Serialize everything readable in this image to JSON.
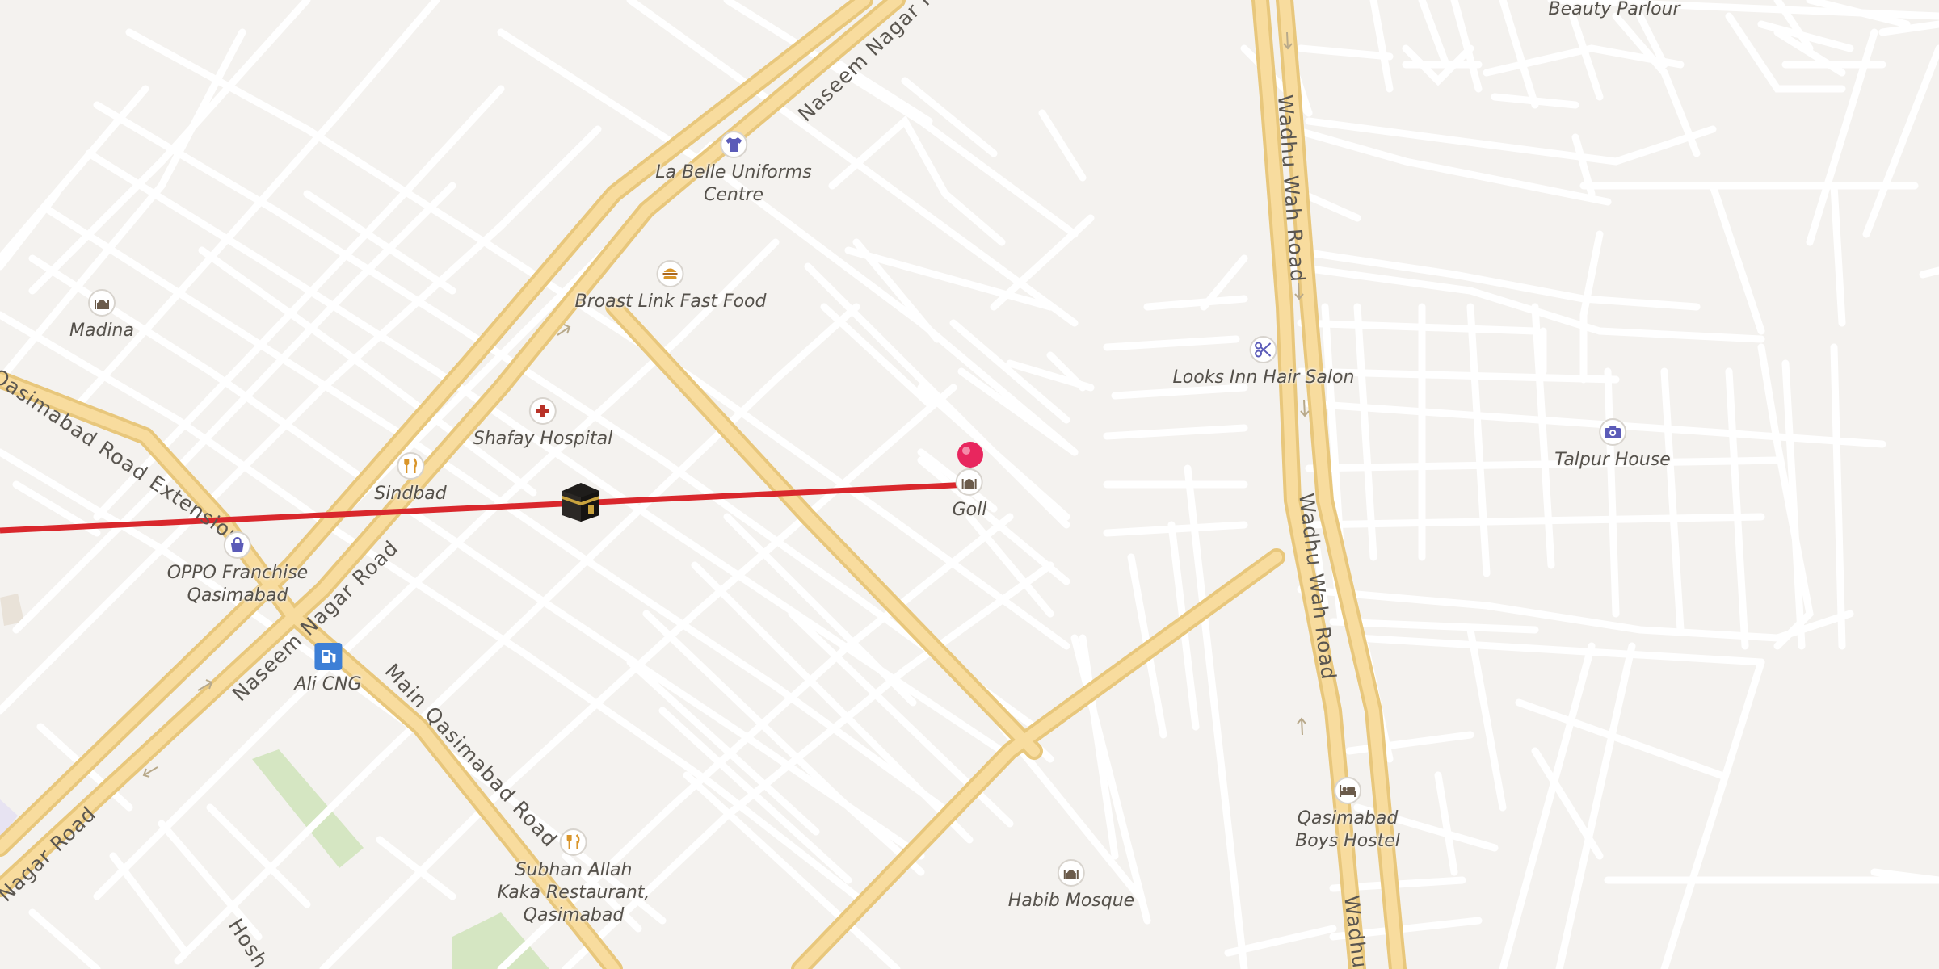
{
  "map": {
    "streets": [
      {
        "id": "naseem-nagar-top",
        "text": "Naseem Nagar Road"
      },
      {
        "id": "naseem-nagar-mid",
        "text": "Naseem Nagar Road"
      },
      {
        "id": "naseem-nagar-bottom",
        "text": "Nagar Road"
      },
      {
        "id": "qasimabad-ext",
        "text": "Qasimabad Road Extension"
      },
      {
        "id": "main-qasimabad",
        "text": "Main Qasimabad Road"
      },
      {
        "id": "wadhu-wah-top",
        "text": "Wadhu Wah Road"
      },
      {
        "id": "wadhu-wah-mid",
        "text": "Wadhu Wah Road"
      },
      {
        "id": "wadhu-wah-bottom",
        "text": "Wadhu"
      },
      {
        "id": "hosh",
        "text": "Hosh"
      }
    ],
    "pois": [
      {
        "id": "la-belle",
        "lines": [
          "La Belle Uniforms",
          "Centre"
        ],
        "icon": "shirt-icon",
        "color": "#5b5bb8"
      },
      {
        "id": "broast-link",
        "lines": [
          "Broast Link Fast Food"
        ],
        "icon": "burger-icon",
        "color": "#d9952a"
      },
      {
        "id": "madina",
        "lines": [
          "Madina"
        ],
        "icon": "mosque-icon",
        "color": "#6b5b4b"
      },
      {
        "id": "shafay",
        "lines": [
          "Shafay Hospital"
        ],
        "icon": "hospital-cross-icon",
        "color": "#b83228"
      },
      {
        "id": "sindbad",
        "lines": [
          "Sindbad"
        ],
        "icon": "restaurant-icon",
        "color": "#d9952a"
      },
      {
        "id": "oppo",
        "lines": [
          "OPPO Franchise",
          "Qasimabad"
        ],
        "icon": "shopping-bag-icon",
        "color": "#5b5bb8"
      },
      {
        "id": "ali-cng",
        "lines": [
          "Ali CNG"
        ],
        "icon": "fuel-icon",
        "color": "#3d7fd6"
      },
      {
        "id": "goll",
        "lines": [
          "Goll"
        ],
        "icon": "mosque-icon",
        "color": "#6b5b4b"
      },
      {
        "id": "looks-inn",
        "lines": [
          "Looks Inn Hair Salon"
        ],
        "icon": "scissors-icon",
        "color": "#5b5bb8"
      },
      {
        "id": "talpur",
        "lines": [
          "Talpur House"
        ],
        "icon": "camera-icon",
        "color": "#5b5bb8"
      },
      {
        "id": "beauty-parlour",
        "lines": [
          "Beauty Parlour"
        ],
        "icon": "",
        "color": ""
      },
      {
        "id": "qasimabad-hostel",
        "lines": [
          "Qasimabad",
          "Boys Hostel"
        ],
        "icon": "bed-icon",
        "color": "#6b5b4b"
      },
      {
        "id": "habib",
        "lines": [
          "Habib Mosque"
        ],
        "icon": "mosque-icon",
        "color": "#6b5b4b"
      },
      {
        "id": "subhan-allah",
        "lines": [
          "Subhan Allah",
          "Kaka Restaurant,",
          "Qasimabad"
        ],
        "icon": "restaurant-icon",
        "color": "#d9952a"
      }
    ],
    "markers": {
      "kaaba": "kaaba-icon",
      "pin": "location-pin-icon"
    },
    "colors": {
      "background": "#f4f2ef",
      "minor_road": "#ffffff",
      "major_road_fill": "#f8dc9e",
      "major_road_casing": "#e8c77c",
      "qibla_line": "#d9272c",
      "park": "#d5e6c2",
      "pin": "#e8265e"
    }
  }
}
